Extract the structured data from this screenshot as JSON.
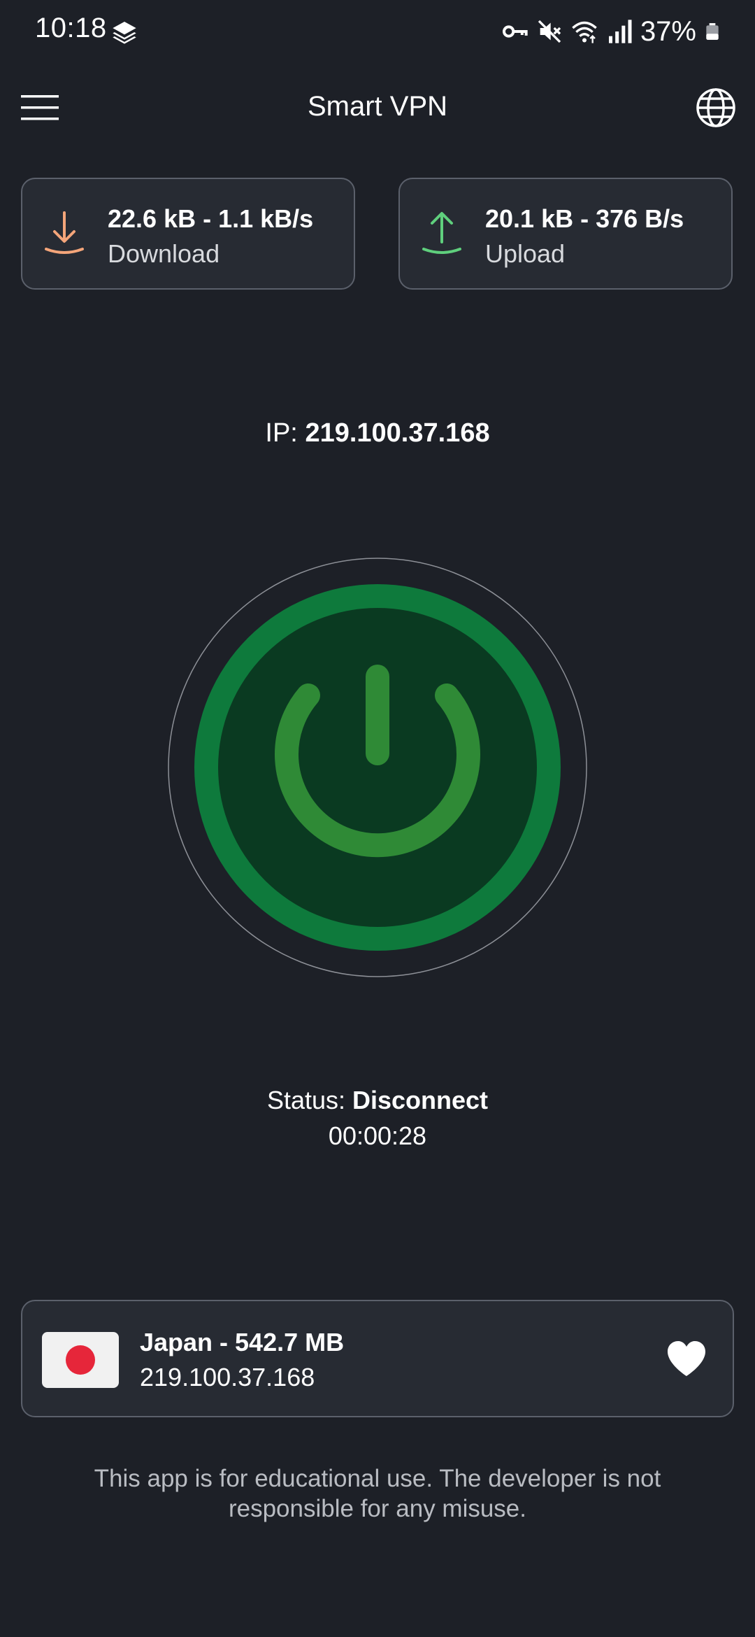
{
  "status_bar": {
    "time": "10:18",
    "battery": "37%",
    "icons": [
      "layers-icon",
      "vpn-key-icon",
      "mute-icon",
      "wifi-icon",
      "signal-icon",
      "battery-icon"
    ]
  },
  "app_bar": {
    "title": "Smart VPN",
    "menu_icon": "hamburger-menu-icon",
    "globe_icon": "globe-icon"
  },
  "traffic": {
    "download": {
      "value": "22.6 kB - 1.1 kB/s",
      "label": "Download",
      "icon": "download-arrow-icon",
      "color": "#f4a57a"
    },
    "upload": {
      "value": "20.1 kB - 376 B/s",
      "label": "Upload",
      "icon": "upload-arrow-icon",
      "color": "#5fcf7d"
    }
  },
  "ip": {
    "label": "IP: ",
    "value": "219.100.37.168"
  },
  "power_button": {
    "icon": "power-icon",
    "ring_color": "#0e7a3c",
    "inner_color": "#0a3a21",
    "symbol_color": "#2f8a36"
  },
  "status": {
    "label": "Status: ",
    "value": "Disconnect",
    "timer": "00:00:28"
  },
  "server": {
    "name": "Japan - 542.7 MB",
    "ip": "219.100.37.168",
    "flag": "japan-flag-icon",
    "favorite_icon": "heart-icon"
  },
  "disclaimer": "This app is for educational use. The developer is not responsible for any misuse.",
  "colors": {
    "background": "#1d2027",
    "card": "#272b33",
    "card_border": "#5b606b"
  }
}
